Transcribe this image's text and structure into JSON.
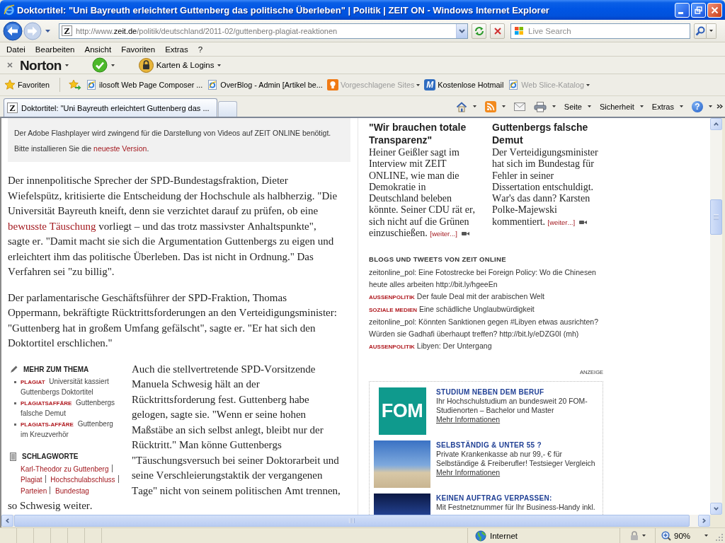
{
  "window": {
    "title": "Doktortitel: \"Uni Bayreuth erleichtert Guttenberg das politische Überleben\" | Politik | ZEIT ON - Windows Internet Explorer"
  },
  "address_bar": {
    "favicon": "Z",
    "url_prefix": "http://www.",
    "domain": "zeit.de",
    "url_path": "/politik/deutschland/2011-02/guttenberg-plagiat-reaktionen"
  },
  "search": {
    "placeholder": "Live Search"
  },
  "menu": [
    "Datei",
    "Bearbeiten",
    "Ansicht",
    "Favoriten",
    "Extras",
    "?"
  ],
  "norton_toolbar": {
    "logo": "Norton",
    "items": [
      {
        "kind": "status",
        "dropdown": true
      },
      {
        "kind": "logins",
        "label": "Karten & Logins",
        "dropdown": true
      }
    ]
  },
  "favorites_bar": {
    "label": "Favoriten",
    "links": [
      {
        "kind": "ie-page",
        "label": "ilosoft Web Page Composer ...",
        "dimmed": false,
        "dropdown": false
      },
      {
        "kind": "ie-page",
        "label": "OverBlog - Admin [Artikel be...",
        "dimmed": false,
        "dropdown": false
      },
      {
        "kind": "bulb",
        "label": "Vorgeschlagene Sites",
        "dimmed": true,
        "dropdown": true
      },
      {
        "kind": "letter-tile",
        "icon_text": "M",
        "label": "Kostenlose Hotmail",
        "dimmed": false,
        "dropdown": false
      },
      {
        "kind": "ie-page",
        "label": "Web Slice-Katalog",
        "dimmed": true,
        "dropdown": true
      }
    ]
  },
  "tabs": [
    {
      "favicon": "Z",
      "label": "Doktortitel: \"Uni Bayreuth erleichtert Guttenberg das ...",
      "selected": true
    }
  ],
  "command_bar": [
    {
      "kind": "home",
      "dropdown": true
    },
    {
      "kind": "feeds",
      "dropdown": true
    },
    {
      "kind": "mail",
      "dropdown": false
    },
    {
      "kind": "print",
      "dropdown": true
    },
    {
      "kind": "menu",
      "label": "Seite",
      "dropdown": true
    },
    {
      "kind": "menu",
      "label": "Sicherheit",
      "dropdown": true
    },
    {
      "kind": "menu",
      "label": "Extras",
      "dropdown": true
    },
    {
      "kind": "help",
      "icon_text": "?",
      "dropdown": true
    }
  ],
  "article": {
    "flash_notice": {
      "lines": [
        {
          "parts": [
            {
              "kind": "text",
              "text": "Der Adobe Flashplayer wird zwingend für die Darstellung von Videos auf ZEIT ONLINE benötigt."
            }
          ]
        },
        {
          "parts": [
            {
              "kind": "text",
              "text": "Bitte installieren Sie die "
            },
            {
              "kind": "link",
              "text": "neueste Version"
            },
            {
              "kind": "text",
              "text": "."
            }
          ]
        }
      ]
    },
    "paragraphs": [
      {
        "parts": [
          {
            "kind": "text",
            "text": "Der innenpolitische Sprecher der SPD-Bundestagsfraktion, Dieter Wiefelspütz, kritisierte die Entscheidung der Hochschule als halbherzig. \"Die Universität Bayreuth kneift, denn sie verzichtet darauf zu prüfen, ob eine "
          },
          {
            "kind": "link",
            "text": "bewusste Täuschung"
          },
          {
            "kind": "text",
            "text": " vorliegt – und das trotz massivster Anhaltspunkte\", sagte er. \"Damit macht sie sich die Argumentation Guttenbergs zu eigen und erleichtert ihm das politische Überleben. Das ist nicht in Ordnung.\" Das Verfahren sei \"zu billig\"."
          }
        ]
      },
      {
        "parts": [
          {
            "kind": "text",
            "text": "Der parlamentarische Geschäftsführer der SPD-Fraktion, Thomas Oppermann, bekräftigte Rücktrittsforderungen an den Verteidigungsminister: \"Guttenberg hat in großem Umfang gefälscht\", sagte er. \"Er hat sich den Doktortitel erschlichen.\""
          }
        ]
      }
    ],
    "related": {
      "heading": "MEHR ZUM THEMA",
      "items": [
        {
          "tag": "PLAGIAT",
          "title": "Universität kassiert Guttenbergs Doktortitel"
        },
        {
          "tag": "PLAGIATSAFFÄRE",
          "title": "Guttenbergs falsche Demut"
        },
        {
          "tag": "PLAGIATS-AFFÄRE",
          "title": "Guttenberg im Kreuzverhör"
        }
      ]
    },
    "keywords": {
      "heading": "SCHLAGWORTE",
      "links": [
        "Karl-Theodor zu Guttenberg",
        "Plagiat",
        "Hochschulabschluss",
        "Parteien",
        "Bundestag"
      ]
    },
    "continued_paragraph": {
      "beside_sidebar": "Auch die stellvertretende SPD-Vorsitzende Manuela Schwesig hält an der Rücktrittsforderung fest. Guttenberg habe gelogen, sagte sie. \"Wenn er seine hohen Maßstäbe an sich selbst anlegt, bleibt nur der Rücktritt.\" Man könne Guttenbergs \"Täuschungsversuch bei seiner Doktorarbeit und seine Verschleierungstaktik der vergangenen Tage\" nicht von seinem politischen Amt trennen,",
      "below_sidebar": "so Schwesig weiter."
    }
  },
  "right_column": {
    "teasers": [
      {
        "title": "\"Wir brauchen totale Transparenz\"",
        "text": "Heiner Geißler sagt im Interview mit ZEIT ONLINE, wie man die Demokratie in Deutschland beleben könnte. Seiner CDU rät er, sich nicht auf die Grünen einzuschießen.",
        "more": "[weiter...]"
      },
      {
        "title": "Guttenbergs falsche Demut",
        "text": "Der Verteidigungsminister hat sich im Bundestag für Fehler in seiner Dissertation entschuldigt. War's das dann? Karsten Polke-Majewski kommentiert.",
        "more": "[weiter...]"
      }
    ],
    "blogs": {
      "heading": "BLOGS UND TWEETS VON ZEIT ONLINE",
      "items": [
        {
          "text": "zeitonline_pol: Eine Fotostrecke bei Foreign Policy: Wo die Chinesen heute alles arbeiten http://bit.ly/hgeeEn"
        },
        {
          "tag": "AUSSENPOLITIK",
          "text": "Der faule Deal mit der arabischen Welt"
        },
        {
          "tag": "SOZIALE MEDIEN",
          "text": "Eine schädliche Unglaubwürdigkeit"
        },
        {
          "text": "zeitonline_pol: Könnten Sanktionen gegen #Libyen etwas ausrichten? Würden sie Gadhafi überhaupt treffen? http://bit.ly/eDZG0I (mh)"
        },
        {
          "tag": "AUSSENPOLITIK",
          "text": "Libyen: Der Untergang"
        }
      ]
    },
    "ads": {
      "label": "ANZEIGE",
      "items": [
        {
          "kind": "logo",
          "logo": "FOM",
          "title": "STUDIUM NEBEN DEM BERUF",
          "text": "Ihr Hochschulstudium an bundesweit 20 FOM-Studienorten – Bachelor und Master",
          "link": "Mehr Informationen"
        },
        {
          "kind": "photo",
          "title": "SELBSTÄNDIG & UNTER 55 ?",
          "text": "Private Krankenkasse ab nur 99,- € für Selbständige & Freiberufler! Testsieger Vergleich",
          "link": "Mehr Informationen"
        },
        {
          "kind": "photo",
          "title": "KEINEN AUFTRAG VERPASSEN:",
          "text": "Mit Festnetznummer für Ihr Business-Handy inkl."
        }
      ]
    }
  },
  "status_bar": {
    "zone": "Internet",
    "zoom": "90%"
  }
}
